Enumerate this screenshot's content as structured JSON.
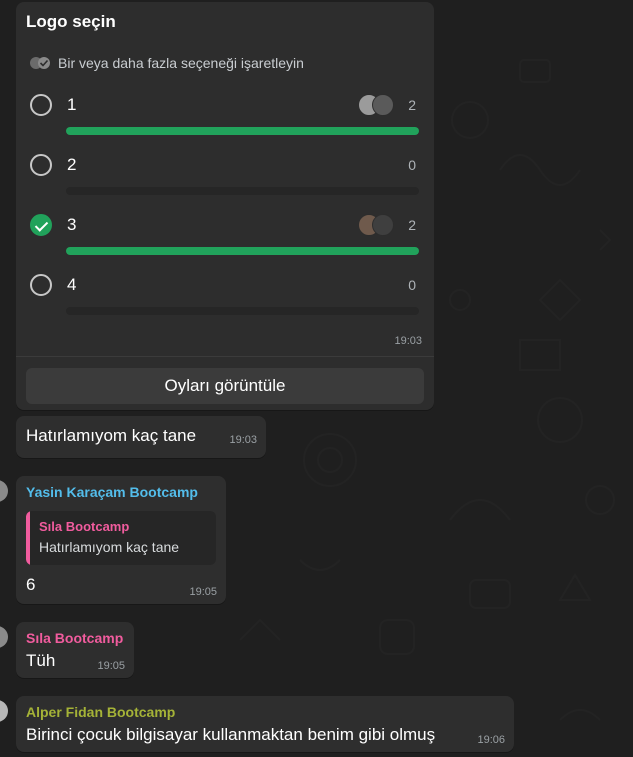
{
  "poll": {
    "title": "Logo seçin",
    "subtitle": "Bir veya daha fazla seçeneği işaretleyin",
    "options": [
      {
        "label": "1",
        "count": "2",
        "fraction": 1.0,
        "checked": false
      },
      {
        "label": "2",
        "count": "0",
        "fraction": 0.0,
        "checked": false
      },
      {
        "label": "3",
        "count": "2",
        "fraction": 1.0,
        "checked": true
      },
      {
        "label": "4",
        "count": "0",
        "fraction": 0.0,
        "checked": false
      }
    ],
    "time": "19:03",
    "view_votes": "Oyları görüntüle"
  },
  "messages": [
    {
      "text": "Hatırlamıyom kaç tane",
      "time": "19:03"
    },
    {
      "sender": "Yasin Karaçam Bootcamp",
      "sender_color": "#53bdeb",
      "quote": {
        "sender": "Sıla Bootcamp",
        "sender_color": "#f15c9e",
        "text": "Hatırlamıyom kaç tane"
      },
      "text": "6",
      "time": "19:05"
    },
    {
      "sender": "Sıla Bootcamp",
      "sender_color": "#f15c9e",
      "text": "Tüh",
      "time": "19:05"
    },
    {
      "sender": "Alper Fidan Bootcamp",
      "sender_color": "#a5b337",
      "text": "Birinci çocuk bilgisayar kullanmaktan benim gibi olmuş",
      "time": "19:06"
    }
  ],
  "colors": {
    "accent": "#21a25b",
    "bubble": "#2e2e2e",
    "background": "#1f1f1f"
  },
  "icons": [
    "double-check-icon",
    "voter-avatar-icon",
    "checkmark-icon"
  ]
}
